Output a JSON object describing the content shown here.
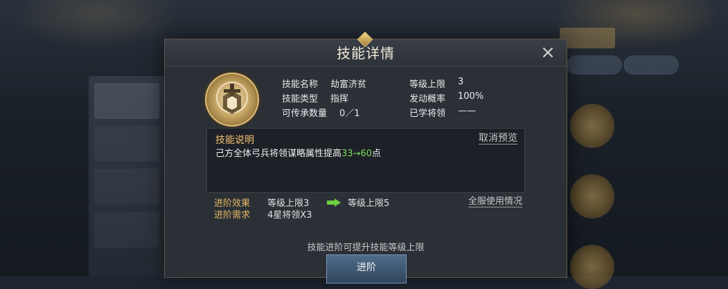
{
  "dialog": {
    "title": "技能详情",
    "close_icon": "×"
  },
  "skill": {
    "name_label": "技能名称",
    "name_value": "劫富济贫",
    "type_label": "技能类型",
    "type_value": "指挥",
    "inherit_label": "可传承数量",
    "inherit_value": "0／1",
    "level_cap_label": "等级上限",
    "level_cap_value": "3",
    "trigger_label": "发动概率",
    "trigger_value": "100%",
    "learned_label": "已学将领",
    "learned_value": "——"
  },
  "description": {
    "title": "技能说明",
    "cancel_preview": "取消预览",
    "text_prefix": "己方全体弓兵将领谋略属性提高",
    "from_value": "33",
    "arrow": "→",
    "to_value": "60",
    "text_suffix": "点"
  },
  "advance": {
    "effect_label": "进阶效果",
    "effect_from": "等级上限3",
    "effect_to": "等级上限5",
    "requirement_label": "进阶需求",
    "requirement_value": "4星将领X3",
    "server_usage": "全服使用情况",
    "hint": "技能进阶可提升技能等级上限",
    "button_label": "进阶"
  },
  "colors": {
    "accent_gold": "#e8b860",
    "green_value": "#7fdc5a",
    "panel_bg": "#2b3037"
  },
  "icons": [
    "close-icon",
    "skill-emblem-icon",
    "arrow-right-icon",
    "left-arrow-icon",
    "right-arrow-icon"
  ]
}
